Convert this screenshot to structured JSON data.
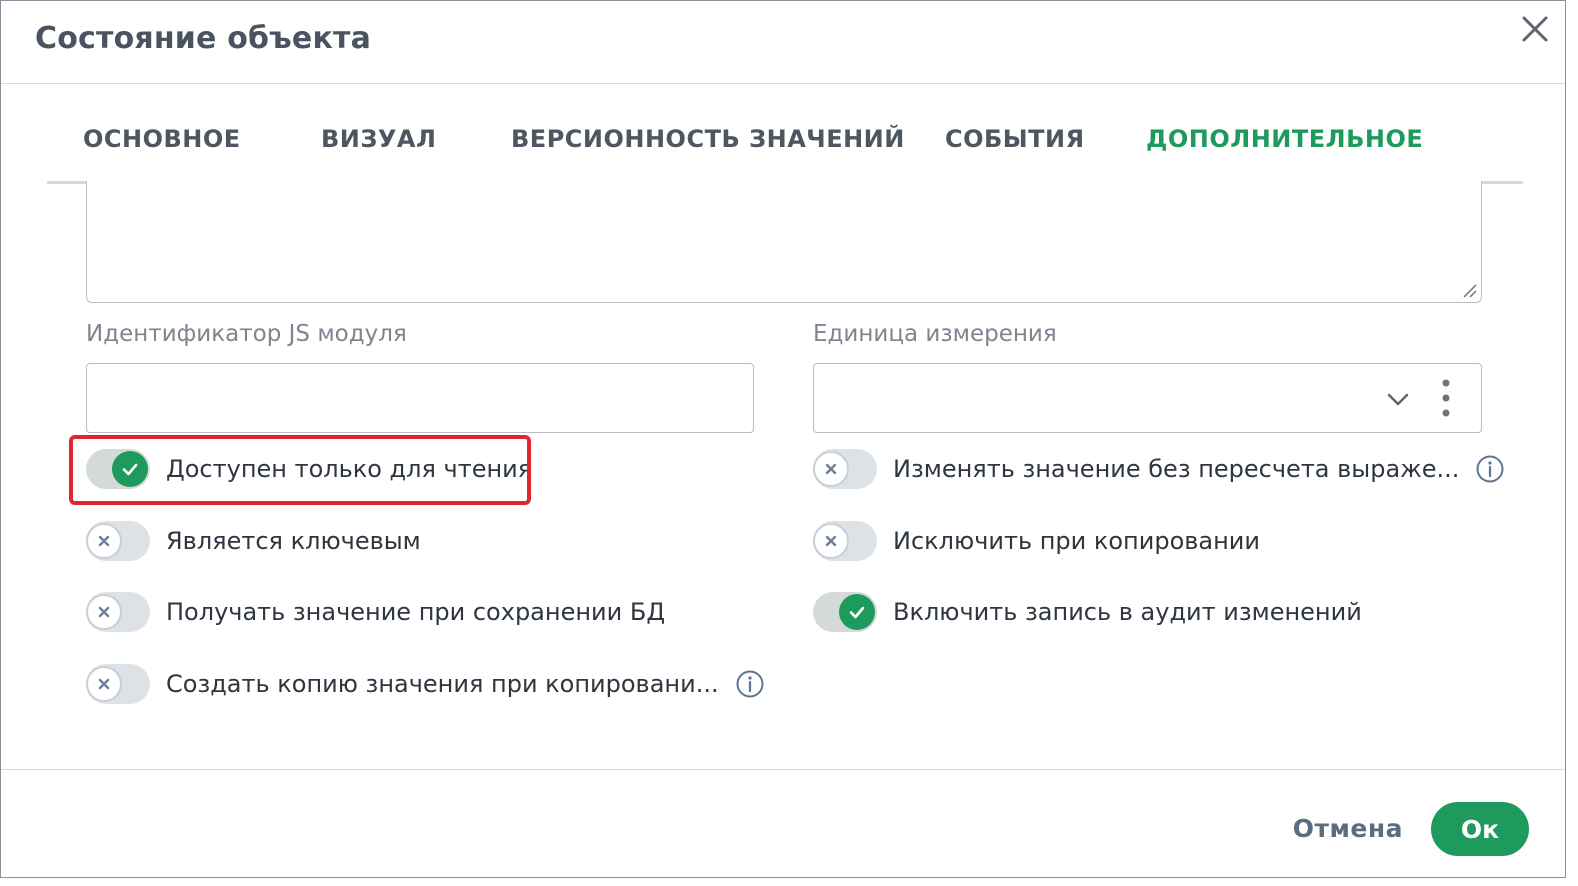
{
  "dialog": {
    "title": "Состояние объекта"
  },
  "tabs": [
    {
      "label": "ОСНОВНОЕ",
      "active": false
    },
    {
      "label": "ВИЗУАЛ",
      "active": false
    },
    {
      "label": "ВЕРСИОННОСТЬ ЗНАЧЕНИЙ",
      "active": false
    },
    {
      "label": "СОБЫТИЯ",
      "active": false
    },
    {
      "label": "ДОПОЛНИТЕЛЬНОЕ",
      "active": true
    }
  ],
  "fields": {
    "js_module": {
      "label": "Идентификатор JS модуля",
      "value": ""
    },
    "unit": {
      "label": "Единица измерения",
      "value": ""
    }
  },
  "toggles_left": [
    {
      "label": "Доступен только для чтения",
      "on": true
    },
    {
      "label": "Является ключевым",
      "on": false
    },
    {
      "label": "Получать значение при сохранении БД",
      "on": false
    },
    {
      "label": "Создать копию значения при копировани...",
      "on": false,
      "info": true
    }
  ],
  "toggles_right": [
    {
      "label": "Изменять значение без пересчета выраже...",
      "on": false,
      "info": true
    },
    {
      "label": "Исключить при копировании",
      "on": false
    },
    {
      "label": "Включить запись в аудит изменений",
      "on": true
    }
  ],
  "footer": {
    "cancel_label": "Отмена",
    "ok_label": "Ок"
  },
  "colors": {
    "accent": "#1e9a5c",
    "highlight": "#e0252e"
  }
}
